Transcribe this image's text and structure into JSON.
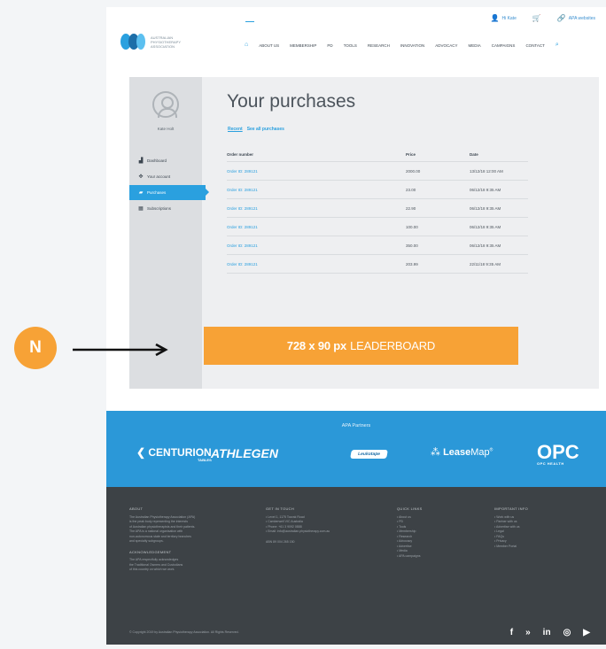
{
  "header": {
    "util_links": [
      {
        "icon": "user-icon",
        "label": "Hi Kate"
      },
      {
        "icon": "cart-icon",
        "label": ""
      },
      {
        "icon": "link-icon",
        "label": "APA websites"
      }
    ],
    "logo_text": "AUSTRALIAN PHYSIOTHERAPY ASSOCIATION",
    "nav": [
      "ABOUT US",
      "MEMBERSHIP",
      "PD",
      "TOOLS",
      "RESEARCH",
      "INNOVATION",
      "ADVOCACY",
      "MEDIA",
      "CAMPAIGNS",
      "CONTACT"
    ]
  },
  "sidebar": {
    "user_name": "Kate Holt",
    "items": [
      {
        "icon": "dashboard-icon",
        "label": "Dashboard"
      },
      {
        "icon": "gear-icon",
        "label": "Your account"
      },
      {
        "icon": "cart-icon",
        "label": "Purchases"
      },
      {
        "icon": "subscriptions-icon",
        "label": "Subscriptions"
      }
    ]
  },
  "main": {
    "title": "Your purchases",
    "tabs": [
      "Recent",
      "See all purchases"
    ],
    "columns": [
      "Order number",
      "Price",
      "Date"
    ],
    "rows": [
      [
        "Order ID: 289121",
        "2000.00",
        "13/12/18 12:00 AM"
      ],
      [
        "Order ID: 289121",
        "23.00",
        "06/12/18 9:35 AM"
      ],
      [
        "Order ID: 289121",
        "22.90",
        "06/12/18 9:35 AM"
      ],
      [
        "Order ID: 289121",
        "100.00",
        "06/12/18 9:35 AM"
      ],
      [
        "Order ID: 289121",
        "350.00",
        "06/12/18 9:35 AM"
      ],
      [
        "Order ID: 289121",
        "203.99",
        "22/11/18 9:35 AM"
      ]
    ]
  },
  "leaderboard": {
    "bold": "728 x 90 px",
    "rest": "LEADERBOARD"
  },
  "partners": {
    "title": "APA Partners",
    "logos": [
      {
        "name": "CENTURION",
        "sub": "TABLES"
      },
      {
        "name": "ATHLEGEN"
      },
      {
        "name": "Leukotape"
      },
      {
        "name_bold": "Lease",
        "name_rest": "Map"
      },
      {
        "name": "OPC",
        "sub": "OPC HEALTH"
      }
    ]
  },
  "footer": {
    "about_title": "ABOUT",
    "about_text": [
      "The Australian Physiotherapy Association (APA)",
      "is the peak body representing the interests",
      "of Australian physiotherapists and their patients.",
      "The APA is a national organisation with",
      "non-autonomous state and territory branches",
      "and specialty subgroups."
    ],
    "ack_title": "ACKNOWLEDGEMENT",
    "ack_text": [
      "The APA respectfully acknowledges",
      "the Traditional Owners and Custodians",
      "of this country on which we work."
    ],
    "contact_title": "GET IN TOUCH",
    "contact_items": [
      "• Level 1, 1175 Toorak Road",
      "• Camberwell VIC Australia",
      "• Phone: +61 3 9092 0888",
      "• Email: info@australian.physiotherapy.com.au"
    ],
    "abn": "ABN 89 004 265 150",
    "quick_title": "QUICK LINKS",
    "quick_items": [
      "• About us",
      "• PD",
      "• Tools",
      "• Membership",
      "• Research",
      "• Advocacy",
      "• Advertise",
      "• Media",
      "• APA campaigns"
    ],
    "info_title": "IMPORTANT INFO",
    "info_items": [
      "• Work with us",
      "• Partner with us",
      "• Advertise with us",
      "• Legal",
      "• FAQs",
      "• Privacy",
      "• Member Portal"
    ],
    "copyright": "© Copyright 2019 by Australian Physiotherapy Association. All Rights Reserved.",
    "social": [
      {
        "icon": "facebook-icon",
        "glyph": "f"
      },
      {
        "icon": "twitter-icon",
        "glyph": "»"
      },
      {
        "icon": "linkedin-icon",
        "glyph": "in"
      },
      {
        "icon": "instagram-icon",
        "glyph": "◎"
      },
      {
        "icon": "youtube-icon",
        "glyph": "▶"
      }
    ]
  },
  "annotation": {
    "badge": "N"
  },
  "colors": {
    "accent": "#2aa0df",
    "leaderboard": "#f7a236",
    "footer": "#3d4246",
    "partners": "#2b98d8"
  }
}
